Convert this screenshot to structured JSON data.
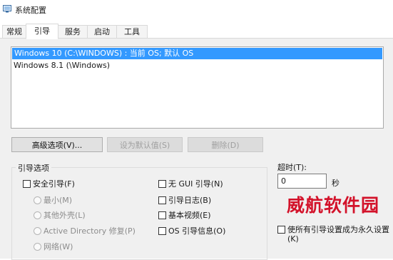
{
  "window": {
    "title": "系统配置"
  },
  "tabs": [
    {
      "label": "常规"
    },
    {
      "label": "引导"
    },
    {
      "label": "服务"
    },
    {
      "label": "启动"
    },
    {
      "label": "工具"
    }
  ],
  "os_list": [
    "Windows 10 (C:\\WINDOWS) : 当前 OS; 默认 OS",
    "Windows 8.1 (\\Windows)"
  ],
  "buttons": {
    "advanced": "高级选项(V)...",
    "set_default": "设为默认值(S)",
    "delete": "删除(D)"
  },
  "boot_options": {
    "label": "引导选项",
    "safe_boot": "安全引导(F)",
    "minimal": "最小(M)",
    "alt_shell": "其他外壳(L)",
    "ad_repair": "Active Directory 修复(P)",
    "network": "网络(W)",
    "no_gui": "无 GUI 引导(N)",
    "boot_log": "引导日志(B)",
    "base_video": "基本视频(E)",
    "os_info": "OS 引导信息(O)"
  },
  "timeout": {
    "label": "超时(T):",
    "value": "0",
    "unit": "秒"
  },
  "make_permanent": "使所有引导设置成为永久设置(K)",
  "watermark": "威航软件园"
}
